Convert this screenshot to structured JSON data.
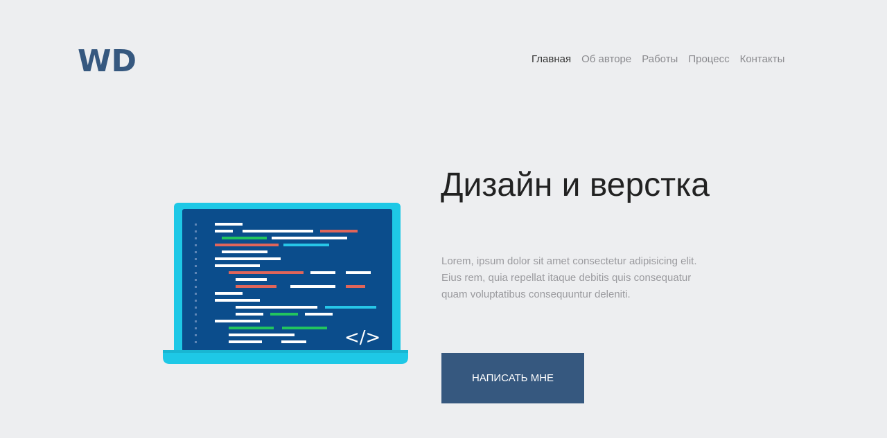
{
  "logo": {
    "text": "WD",
    "color": "#36587f"
  },
  "nav": {
    "items": [
      {
        "label": "Главная",
        "active": true
      },
      {
        "label": "Об авторе",
        "active": false
      },
      {
        "label": "Работы",
        "active": false
      },
      {
        "label": "Процесс",
        "active": false
      },
      {
        "label": "Контакты",
        "active": false
      }
    ]
  },
  "hero": {
    "title": "Дизайн и верстка",
    "text": "Lorem, ipsum dolor sit amet consectetur adipisicing elit. Eius rem, quia repellat itaque debitis quis consequatur quam voluptatibus consequuntur deleniti.",
    "cta_label": "НАПИСАТЬ МНЕ",
    "illustration_icon": "code-brackets-icon",
    "code_symbol": "</>"
  },
  "colors": {
    "background": "#edeef0",
    "accent": "#36587f",
    "screen": "#0b4d8c",
    "laptop_frame": "#1ec8e6"
  }
}
